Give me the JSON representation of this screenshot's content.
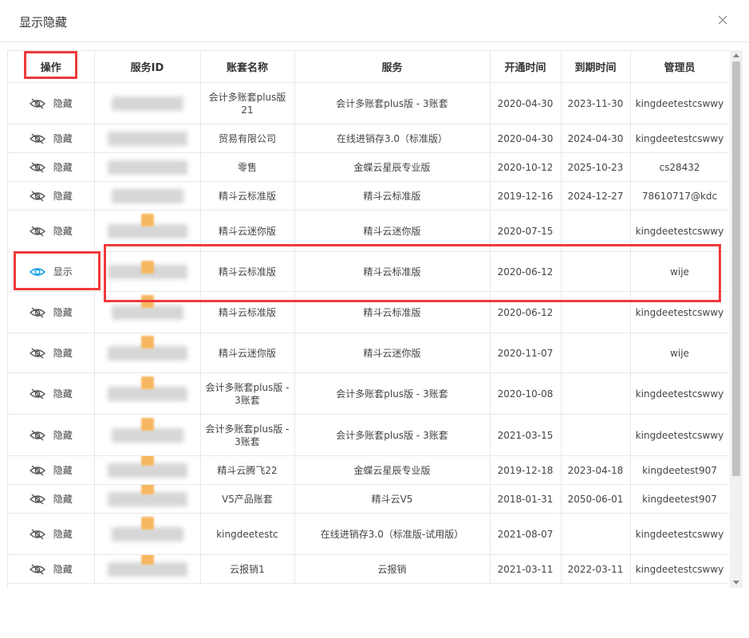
{
  "dialog": {
    "title": "显示隐藏"
  },
  "columns": [
    "操作",
    "服务ID",
    "账套名称",
    "服务",
    "开通时间",
    "到期时间",
    "管理员"
  ],
  "rows": [
    {
      "op": "隐藏",
      "sid": "7 0",
      "account": "会计多账套plus版21",
      "service": "会计多账套plus版 - 3账套",
      "open": "2020-04-30",
      "expire": "2023-11-30",
      "admin": "kingdeetestcswwy",
      "h": 52
    },
    {
      "op": "隐藏",
      "sid": "7 6",
      "account": "贸易有限公司",
      "service": "在线进销存3.0（标准版）",
      "open": "2020-04-30",
      "expire": "2024-04-30",
      "admin": "kingdeetestcswwy",
      "h": 36
    },
    {
      "op": "隐藏",
      "sid": "",
      "account": "零售",
      "service": "金蝶云星辰专业版",
      "open": "2020-10-12",
      "expire": "2025-10-23",
      "admin": "cs28432",
      "h": 36
    },
    {
      "op": "隐藏",
      "sid": "",
      "account": "精斗云标准版",
      "service": "精斗云标准版",
      "open": "2019-12-16",
      "expire": "2024-12-27",
      "admin": "78610717@kdc",
      "h": 36
    },
    {
      "op": "隐藏",
      "sid": "",
      "account": "精斗云迷你版",
      "service": "精斗云迷你版",
      "open": "2020-07-15",
      "expire": "",
      "admin": "kingdeetestcswwy",
      "h": 52
    },
    {
      "op": "显示",
      "sid": "796",
      "account": "精斗云标准版",
      "service": "精斗云标准版",
      "open": "2020-06-12",
      "expire": "",
      "admin": "wije",
      "h": 50,
      "shown": true
    },
    {
      "op": "隐藏",
      "sid": "",
      "account": "精斗云标准版",
      "service": "精斗云标准版",
      "open": "2020-06-12",
      "expire": "",
      "admin": "kingdeetestcswwy",
      "h": 52
    },
    {
      "op": "隐藏",
      "sid": "",
      "account": "精斗云迷你版",
      "service": "精斗云迷你版",
      "open": "2020-11-07",
      "expire": "",
      "admin": "wije",
      "h": 50
    },
    {
      "op": "隐藏",
      "sid": "",
      "account": "会计多账套plus版 - 3账套",
      "service": "会计多账套plus版 - 3账套",
      "open": "2020-10-08",
      "expire": "",
      "admin": "kingdeetestcswwy",
      "h": 52
    },
    {
      "op": "隐藏",
      "sid": "",
      "account": "会计多账套plus版 - 3账套",
      "service": "会计多账套plus版 - 3账套",
      "open": "2021-03-15",
      "expire": "",
      "admin": "kingdeetestcswwy",
      "h": 52
    },
    {
      "op": "隐藏",
      "sid": "",
      "account": "精斗云腾飞22",
      "service": "金蝶云星辰专业版",
      "open": "2019-12-18",
      "expire": "2023-04-18",
      "admin": "kingdeetest907",
      "h": 36
    },
    {
      "op": "隐藏",
      "sid": "",
      "account": "V5产品账套",
      "service": "精斗云V5",
      "open": "2018-01-31",
      "expire": "2050-06-01",
      "admin": "kingdeetest907",
      "h": 36
    },
    {
      "op": "隐藏",
      "sid": "",
      "account": "kingdeetestc",
      "service": "在线进销存3.0（标准版-试用版）",
      "open": "2021-08-07",
      "expire": "",
      "admin": "kingdeetestcswwy",
      "h": 52
    },
    {
      "op": "隐藏",
      "sid": "",
      "account": "云报销1",
      "service": "云报销",
      "open": "2021-03-11",
      "expire": "2022-03-11",
      "admin": "kingdeetestcswwy",
      "h": 36
    }
  ]
}
